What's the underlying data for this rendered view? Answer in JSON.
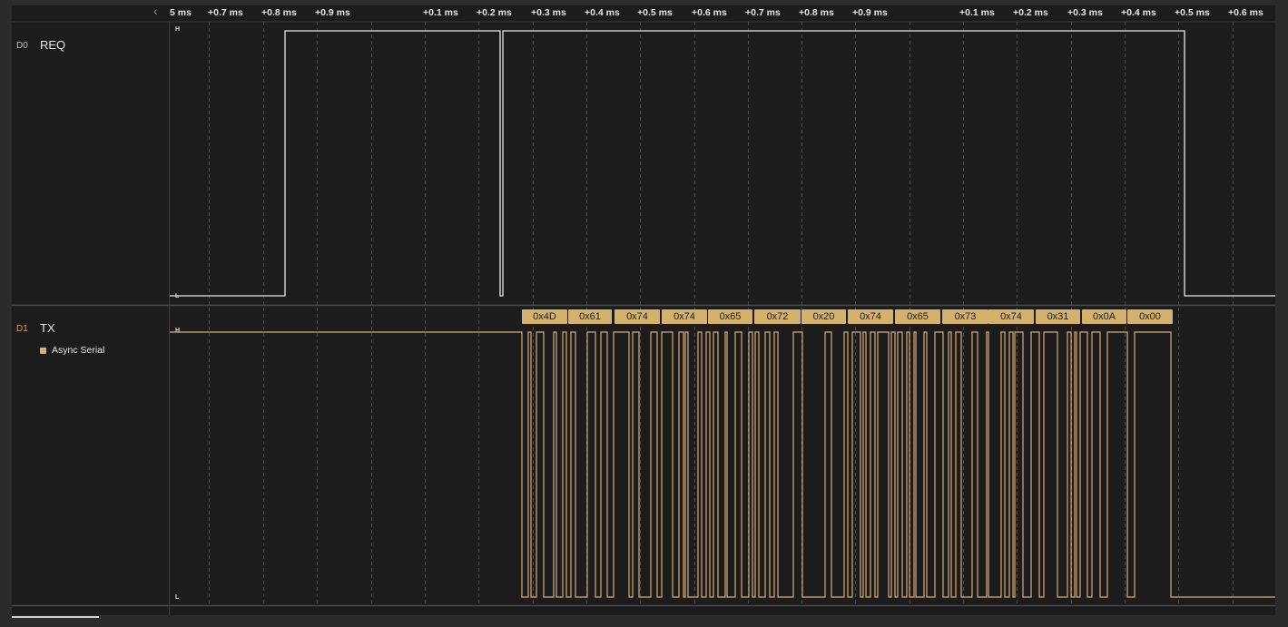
{
  "colors": {
    "background": "#1c1c1c",
    "grid": "#4a4a4a",
    "d0_signal": "#e8e8e8",
    "d1_signal": "#d9a877",
    "byte_label_bg": "#d4b16c",
    "d1_id": "#d69a60",
    "d0_id": "#bfbfbf"
  },
  "timeline": {
    "collapse_icon": "chevron-left-icon",
    "ticks": [
      "5 ms",
      "+0.7 ms",
      "+0.8 ms",
      "+0.9 ms",
      "+0.1 ms",
      "+0.2 ms",
      "+0.3 ms",
      "+0.4 ms",
      "+0.5 ms",
      "+0.6 ms",
      "+0.7 ms",
      "+0.8 ms",
      "+0.9 ms",
      "+0.1 ms",
      "+0.2 ms",
      "+0.3 ms",
      "+0.4 ms",
      "+0.5 ms",
      "+0.6 ms"
    ]
  },
  "channels": [
    {
      "id": "D0",
      "name": "REQ",
      "level_high": "H",
      "level_low": "L"
    },
    {
      "id": "D1",
      "name": "TX",
      "level_high": "H",
      "level_low": "L",
      "analyzer": "Async Serial",
      "decoded_bytes": [
        "0x4D",
        "0x61",
        "0x74",
        "0x74",
        "0x65",
        "0x72",
        "0x20",
        "0x74",
        "0x65",
        "0x73",
        "0x74",
        "0x31",
        "0x0A",
        "0x00"
      ]
    }
  ]
}
